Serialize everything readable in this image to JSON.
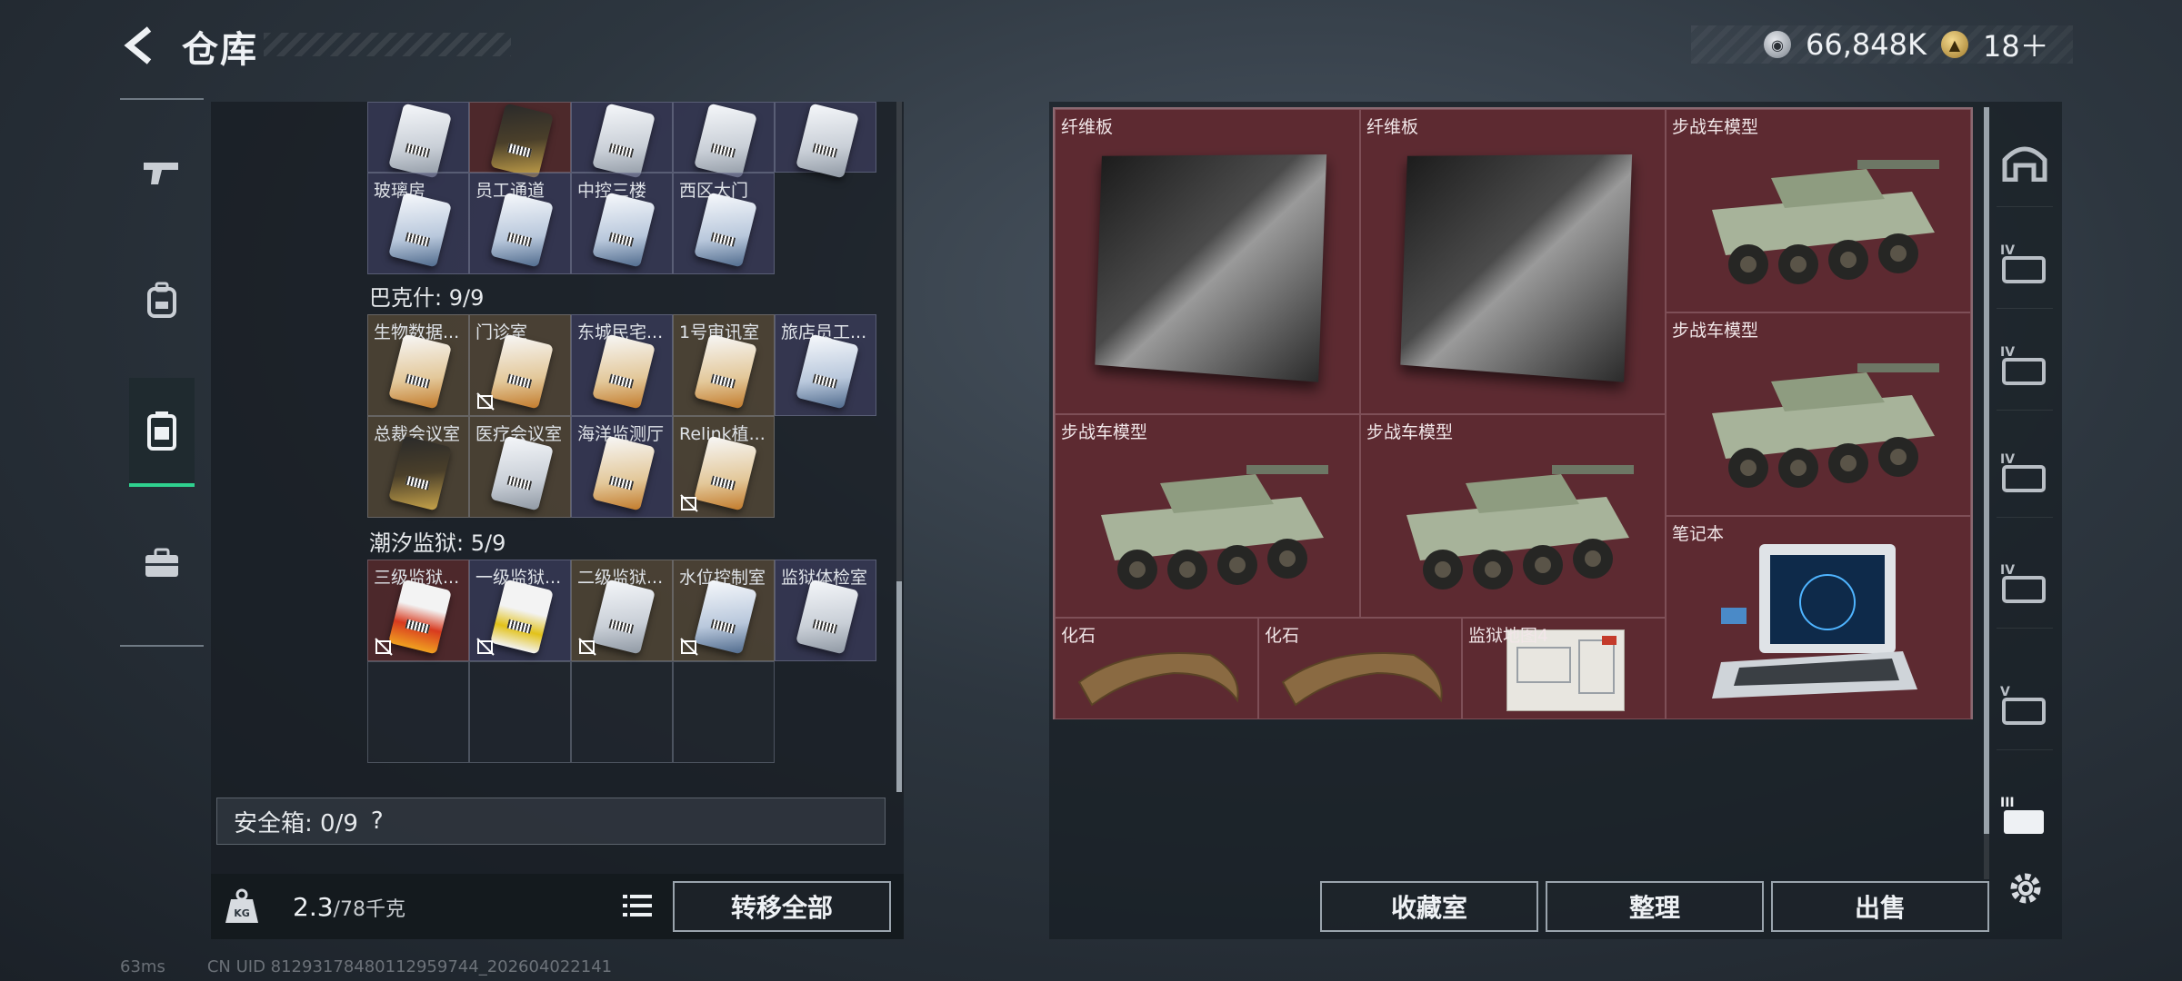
{
  "header": {
    "title": "仓库",
    "currency_silver": "66,848K",
    "currency_gold": "18＋"
  },
  "left_nav": {
    "items": [
      "gun-icon",
      "backpack-icon",
      "storage-icon",
      "briefcase-icon"
    ],
    "active": "storage-icon"
  },
  "inventory": {
    "top_row_labels": [
      "",
      "",
      "",
      "",
      ""
    ],
    "row2_labels": [
      "玻璃房",
      "员工通道",
      "中控三楼",
      "西区大门"
    ],
    "section_bakesh": {
      "title": "巴克什: 9/9"
    },
    "bakesh_row1": [
      "生物数据...",
      "门诊室",
      "东城民宅...",
      "1号审讯室",
      "旅店员工..."
    ],
    "bakesh_row2": [
      "总裁会议室",
      "医疗会议室",
      "海洋监测厅",
      "Relink植..."
    ],
    "section_tide": {
      "title": "潮汐监狱: 5/9"
    },
    "tide_row1": [
      "三级监狱...",
      "一级监狱...",
      "二级监狱...",
      "水位控制室",
      "监狱体检室"
    ]
  },
  "safebox": {
    "label": "安全箱: 0/9",
    "help": "?"
  },
  "weight": {
    "current": "2.3",
    "max": "/78千克"
  },
  "buttons": {
    "transfer_all": "转移全部",
    "collection_room": "收藏室",
    "organize": "整理",
    "sell": "出售"
  },
  "storage": {
    "items": [
      {
        "label": "纤维板"
      },
      {
        "label": "纤维板"
      },
      {
        "label": "步战车模型"
      },
      {
        "label": "步战车模型"
      },
      {
        "label": "步战车模型"
      },
      {
        "label": "步战车模型"
      },
      {
        "label": "笔记本"
      },
      {
        "label": "化石"
      },
      {
        "label": "化石"
      },
      {
        "label": "监狱地图4"
      }
    ]
  },
  "right_filters": [
    "arch-icon",
    "tier-IV-icon",
    "tier-IV-icon",
    "tier-IV-icon",
    "tier-IV-icon",
    "tier-V-icon",
    "tier-III-icon"
  ],
  "filter_labels": [
    "IV",
    "IV",
    "IV",
    "IV",
    "V",
    "III"
  ],
  "status": {
    "ping": "63ms",
    "uid": "CN UID 8129317848011295974​4_202604022141"
  },
  "colors": {
    "accent_green": "#2fd18f",
    "storage_bg": "#5d2a31",
    "panel_bg": "#181e24"
  }
}
